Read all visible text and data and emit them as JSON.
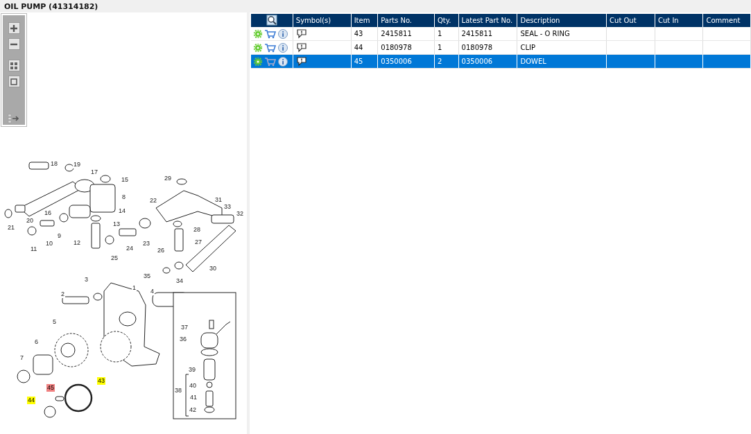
{
  "title": "OIL PUMP (41314182)",
  "toolbar": [
    {
      "kind": "zoom-in"
    },
    {
      "kind": "zoom-out"
    },
    {
      "kind": "fit"
    },
    {
      "kind": "actual-size"
    },
    {
      "kind": "parts-list"
    }
  ],
  "callouts": [
    {
      "label": "18",
      "highlighted": false,
      "selected": false
    },
    {
      "label": "19",
      "highlighted": false,
      "selected": false
    },
    {
      "label": "17",
      "highlighted": false,
      "selected": false
    },
    {
      "label": "15",
      "highlighted": false,
      "selected": false
    },
    {
      "label": "8",
      "highlighted": false,
      "selected": false
    },
    {
      "label": "16",
      "highlighted": false,
      "selected": false
    },
    {
      "label": "20",
      "highlighted": false,
      "selected": false
    },
    {
      "label": "21",
      "highlighted": false,
      "selected": false
    },
    {
      "label": "14",
      "highlighted": false,
      "selected": false
    },
    {
      "label": "13",
      "highlighted": false,
      "selected": false
    },
    {
      "label": "9",
      "highlighted": false,
      "selected": false
    },
    {
      "label": "10",
      "highlighted": false,
      "selected": false
    },
    {
      "label": "11",
      "highlighted": false,
      "selected": false
    },
    {
      "label": "12",
      "highlighted": false,
      "selected": false
    },
    {
      "label": "25",
      "highlighted": false,
      "selected": false
    },
    {
      "label": "24",
      "highlighted": false,
      "selected": false
    },
    {
      "label": "23",
      "highlighted": false,
      "selected": false
    },
    {
      "label": "26",
      "highlighted": false,
      "selected": false
    },
    {
      "label": "22",
      "highlighted": false,
      "selected": false
    },
    {
      "label": "29",
      "highlighted": false,
      "selected": false
    },
    {
      "label": "31",
      "highlighted": false,
      "selected": false
    },
    {
      "label": "33",
      "highlighted": false,
      "selected": false
    },
    {
      "label": "32",
      "highlighted": false,
      "selected": false
    },
    {
      "label": "28",
      "highlighted": false,
      "selected": false
    },
    {
      "label": "27",
      "highlighted": false,
      "selected": false
    },
    {
      "label": "30",
      "highlighted": false,
      "selected": false
    },
    {
      "label": "35",
      "highlighted": false,
      "selected": false
    },
    {
      "label": "34",
      "highlighted": false,
      "selected": false
    },
    {
      "label": "3",
      "highlighted": false,
      "selected": false
    },
    {
      "label": "1",
      "highlighted": false,
      "selected": false
    },
    {
      "label": "4",
      "highlighted": false,
      "selected": false
    },
    {
      "label": "2",
      "highlighted": false,
      "selected": false
    },
    {
      "label": "5",
      "highlighted": false,
      "selected": false
    },
    {
      "label": "6",
      "highlighted": false,
      "selected": false
    },
    {
      "label": "7",
      "highlighted": false,
      "selected": false
    },
    {
      "label": "37",
      "highlighted": false,
      "selected": false
    },
    {
      "label": "36",
      "highlighted": false,
      "selected": false
    },
    {
      "label": "39",
      "highlighted": false,
      "selected": false
    },
    {
      "label": "40",
      "highlighted": false,
      "selected": false
    },
    {
      "label": "38",
      "highlighted": false,
      "selected": false
    },
    {
      "label": "41",
      "highlighted": false,
      "selected": false
    },
    {
      "label": "42",
      "highlighted": false,
      "selected": false
    },
    {
      "label": "43",
      "highlighted": true,
      "selected": false
    },
    {
      "label": "45",
      "highlighted": true,
      "selected": true
    },
    {
      "label": "44",
      "highlighted": true,
      "selected": false
    }
  ],
  "table": {
    "columns": [
      "Symbol(s)",
      "Item",
      "Parts No.",
      "Qty.",
      "Latest Part No.",
      "Description",
      "Cut Out",
      "Cut In",
      "Comment"
    ],
    "rows": [
      {
        "selected": false,
        "item": "43",
        "parts_no": "2415811",
        "qty": "1",
        "latest_part_no": "2415811",
        "description": "SEAL - O RING"
      },
      {
        "selected": false,
        "item": "44",
        "parts_no": "0180978",
        "qty": "1",
        "latest_part_no": "0180978",
        "description": "CLIP"
      },
      {
        "selected": true,
        "item": "45",
        "parts_no": "0350006",
        "qty": "2",
        "latest_part_no": "0350006",
        "description": "DOWEL"
      }
    ]
  }
}
